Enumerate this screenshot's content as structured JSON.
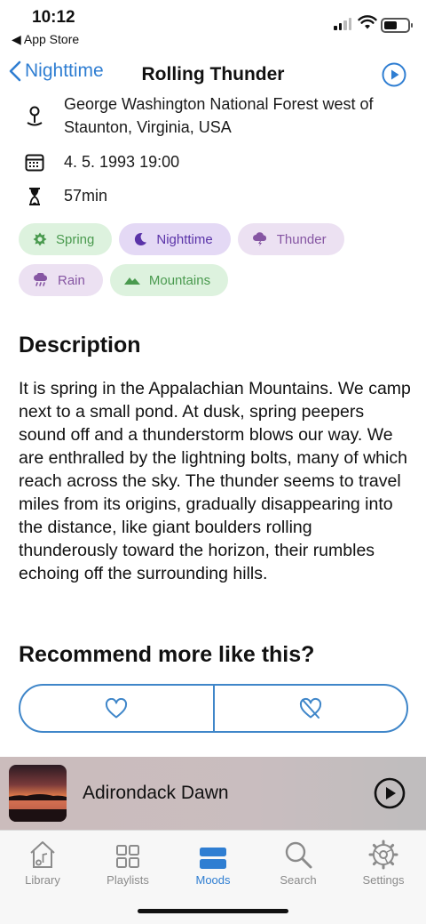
{
  "status_bar": {
    "time": "10:12",
    "back_app": "◀ App Store"
  },
  "nav": {
    "back_label": "Nighttime",
    "title": "Rolling Thunder"
  },
  "details": {
    "location_line1": "George Washington National Forest west of",
    "location_line2": "Staunton, Virginia, USA",
    "date": "4. 5. 1993 19:00",
    "duration": "57min"
  },
  "tags": [
    {
      "label": "Spring",
      "icon": "flower-icon",
      "color": "#4a9a4f"
    },
    {
      "label": "Nighttime",
      "icon": "moon-icon",
      "color": "#5a33a8"
    },
    {
      "label": "Thunder",
      "icon": "thunder-cloud-icon",
      "color": "#8656a3"
    },
    {
      "label": "Rain",
      "icon": "rain-cloud-icon",
      "color": "#8656a3"
    },
    {
      "label": "Mountains",
      "icon": "mountains-icon",
      "color": "#4a9a4f"
    }
  ],
  "description": {
    "heading": "Description",
    "text": "It is spring in the Appalachian Mountains. We camp next to a small pond. At dusk, spring peepers sound off and a thunderstorm blows our way. We are enthralled by the lightning bolts, many of which reach across the sky. The thunder seems to travel miles from its origins, gradually disappearing into the distance, like giant boulders rolling thunderously toward the horizon, their rumbles echoing off the surrounding hills."
  },
  "recommend": {
    "heading": "Recommend more like this?"
  },
  "mini_player": {
    "title": "Adirondack Dawn"
  },
  "tab_bar": {
    "items": [
      {
        "label": "Library",
        "icon": "library-icon",
        "active": false
      },
      {
        "label": "Playlists",
        "icon": "grid-icon",
        "active": false
      },
      {
        "label": "Moods",
        "icon": "moods-icon",
        "active": true
      },
      {
        "label": "Search",
        "icon": "search-icon",
        "active": false
      },
      {
        "label": "Settings",
        "icon": "gear-icon",
        "active": false
      }
    ]
  },
  "colors": {
    "accent": "#2f7ed2",
    "outline": "#3f86c9"
  }
}
